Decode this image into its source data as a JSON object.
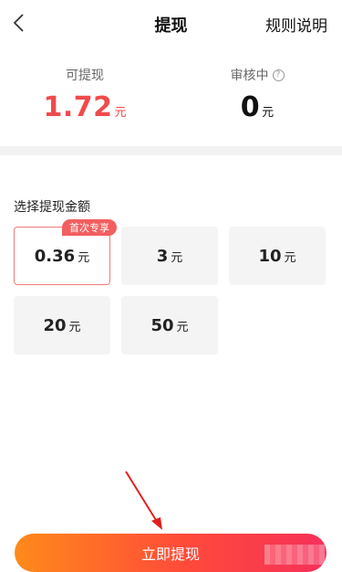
{
  "header": {
    "back_icon": "chevron-left-icon",
    "title": "提现",
    "rules_label": "规则说明"
  },
  "balance": {
    "available": {
      "label": "可提现",
      "amount": "1.72",
      "unit": "元",
      "color": "#f04b4b"
    },
    "pending": {
      "label": "审核中",
      "amount": "0",
      "unit": "元",
      "help_icon": "question-circle-icon"
    }
  },
  "amounts": {
    "section_title": "选择提现金额",
    "options": [
      {
        "amount": "0.36",
        "unit": "元",
        "badge": "首次专享",
        "selected": true
      },
      {
        "amount": "3",
        "unit": "元"
      },
      {
        "amount": "10",
        "unit": "元"
      },
      {
        "amount": "20",
        "unit": "元"
      },
      {
        "amount": "50",
        "unit": "元"
      }
    ]
  },
  "submit": {
    "label": "立即提现"
  },
  "colors": {
    "accent": "#f04b4b",
    "button_start": "#ff8a1a",
    "button_end": "#f5305a"
  }
}
